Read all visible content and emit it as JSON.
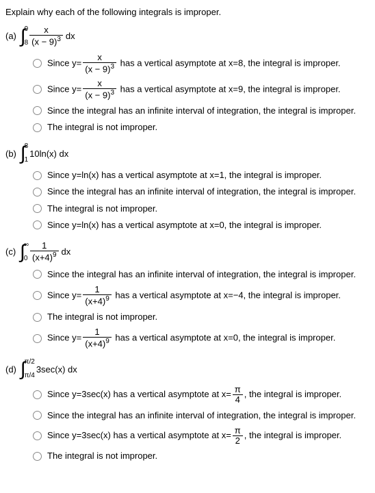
{
  "prompt": "Explain why each of the following integrals is improper.",
  "parts": {
    "a": {
      "label": "(a)",
      "integral": {
        "low": "8",
        "up": "9",
        "num": "x",
        "den_base": "(x − 9)",
        "den_pow": "3",
        "dx": "dx"
      },
      "options": [
        {
          "pre": "Since ",
          "y": "y=",
          "frac_num": "x",
          "frac_den_base": "(x − 9)",
          "frac_den_pow": "3",
          "post": " has a vertical asymptote at x=8, the integral is improper."
        },
        {
          "pre": "Since ",
          "y": "y=",
          "frac_num": "x",
          "frac_den_base": "(x − 9)",
          "frac_den_pow": "3",
          "post": " has a vertical asymptote at x=9, the integral is improper."
        },
        {
          "text": "Since the integral has an infinite interval of integration, the integral is improper."
        },
        {
          "text": "The integral is not improper."
        }
      ]
    },
    "b": {
      "label": "(b)",
      "integral": {
        "low": "1",
        "up": "8",
        "body": "10ln(x) dx"
      },
      "options": [
        {
          "text": "Since y=ln(x) has a vertical asymptote at x=1, the integral is improper."
        },
        {
          "text": "Since the integral has an infinite interval of integration, the integral is improper."
        },
        {
          "text": "The integral is not improper."
        },
        {
          "text": "Since y=ln(x) has a vertical asymptote at x=0, the integral is improper."
        }
      ]
    },
    "c": {
      "label": "(c)",
      "integral": {
        "low": "0",
        "up": "∞",
        "num": "1",
        "den_base": "(x+4)",
        "den_pow": "9",
        "dx": "dx"
      },
      "options": [
        {
          "text": "Since the integral has an infinite interval of integration, the integral is improper."
        },
        {
          "pre": "Since ",
          "y": "y=",
          "frac_num": "1",
          "frac_den_base": "(x+4)",
          "frac_den_pow": "9",
          "post": " has a vertical asymptote at x=−4, the integral is improper."
        },
        {
          "text": "The integral is not improper."
        },
        {
          "pre": "Since ",
          "y": "y=",
          "frac_num": "1",
          "frac_den_base": "(x+4)",
          "frac_den_pow": "9",
          "post": " has a vertical asymptote at x=0, the integral is improper."
        }
      ]
    },
    "d": {
      "label": "(d)",
      "integral": {
        "low": "π/4",
        "up": "π/2",
        "body": "3sec(x) dx"
      },
      "options": [
        {
          "pre": "Since y=3sec(x) has a vertical asymptote at x=",
          "frac_num": "π",
          "frac_den": "4",
          "post": ", the integral is improper."
        },
        {
          "text": "Since the integral has an infinite interval of integration, the integral is improper."
        },
        {
          "pre": "Since y=3sec(x) has a vertical asymptote at x=",
          "frac_num": "π",
          "frac_den": "2",
          "post": ", the integral is improper."
        },
        {
          "text": "The integral is not improper."
        }
      ]
    }
  }
}
